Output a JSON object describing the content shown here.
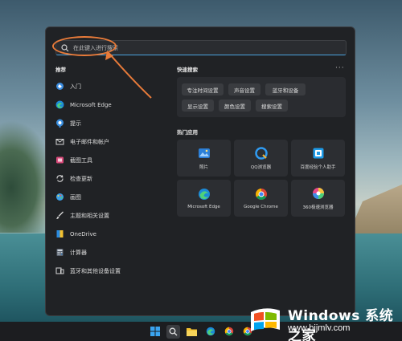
{
  "search": {
    "placeholder": "在此键入进行搜索"
  },
  "recommended": {
    "title": "推荐",
    "items": [
      {
        "label": "入门",
        "icon": "get-started-icon"
      },
      {
        "label": "Microsoft Edge",
        "icon": "edge-icon"
      },
      {
        "label": "提示",
        "icon": "tips-icon"
      },
      {
        "label": "电子邮件和帐户",
        "icon": "mail-icon"
      },
      {
        "label": "截图工具",
        "icon": "snipping-tool-icon"
      },
      {
        "label": "检查更新",
        "icon": "update-icon"
      },
      {
        "label": "画图",
        "icon": "paint-icon"
      },
      {
        "label": "主题和相关设置",
        "icon": "theme-brush-icon"
      },
      {
        "label": "OneDrive",
        "icon": "onedrive-icon"
      },
      {
        "label": "计算器",
        "icon": "calculator-icon"
      },
      {
        "label": "蓝牙和其他设备设置",
        "icon": "bluetooth-devices-icon"
      }
    ]
  },
  "quick_search": {
    "title": "快速搜索",
    "more": "···",
    "chips": [
      "专注时间设置",
      "声音设置",
      "蓝牙和设备",
      "显示设置",
      "颜色设置",
      "搜索设置"
    ]
  },
  "top_apps": {
    "title": "热门应用",
    "tiles": [
      {
        "label": "照片",
        "icon": "photos-icon"
      },
      {
        "label": "QQ浏览器",
        "icon": "qq-browser-icon"
      },
      {
        "label": "百度经验个人助手",
        "icon": "baidu-jingyan-icon"
      },
      {
        "label": "Microsoft Edge",
        "icon": "edge-icon"
      },
      {
        "label": "Google Chrome",
        "icon": "chrome-icon"
      },
      {
        "label": "360极速浏览器",
        "icon": "360-browser-icon"
      }
    ]
  },
  "taskbar": {
    "icons": [
      "windows-start-icon",
      "search-icon",
      "file-explorer-icon",
      "edge-icon",
      "chrome-icon",
      "chrome-icon"
    ]
  },
  "watermark": {
    "title": "Windows 系统之家",
    "url": "www.bjjmlv.com"
  },
  "colors": {
    "accent": "#4aa3df",
    "annotation": "#e87b3a",
    "panel": "#202225"
  }
}
